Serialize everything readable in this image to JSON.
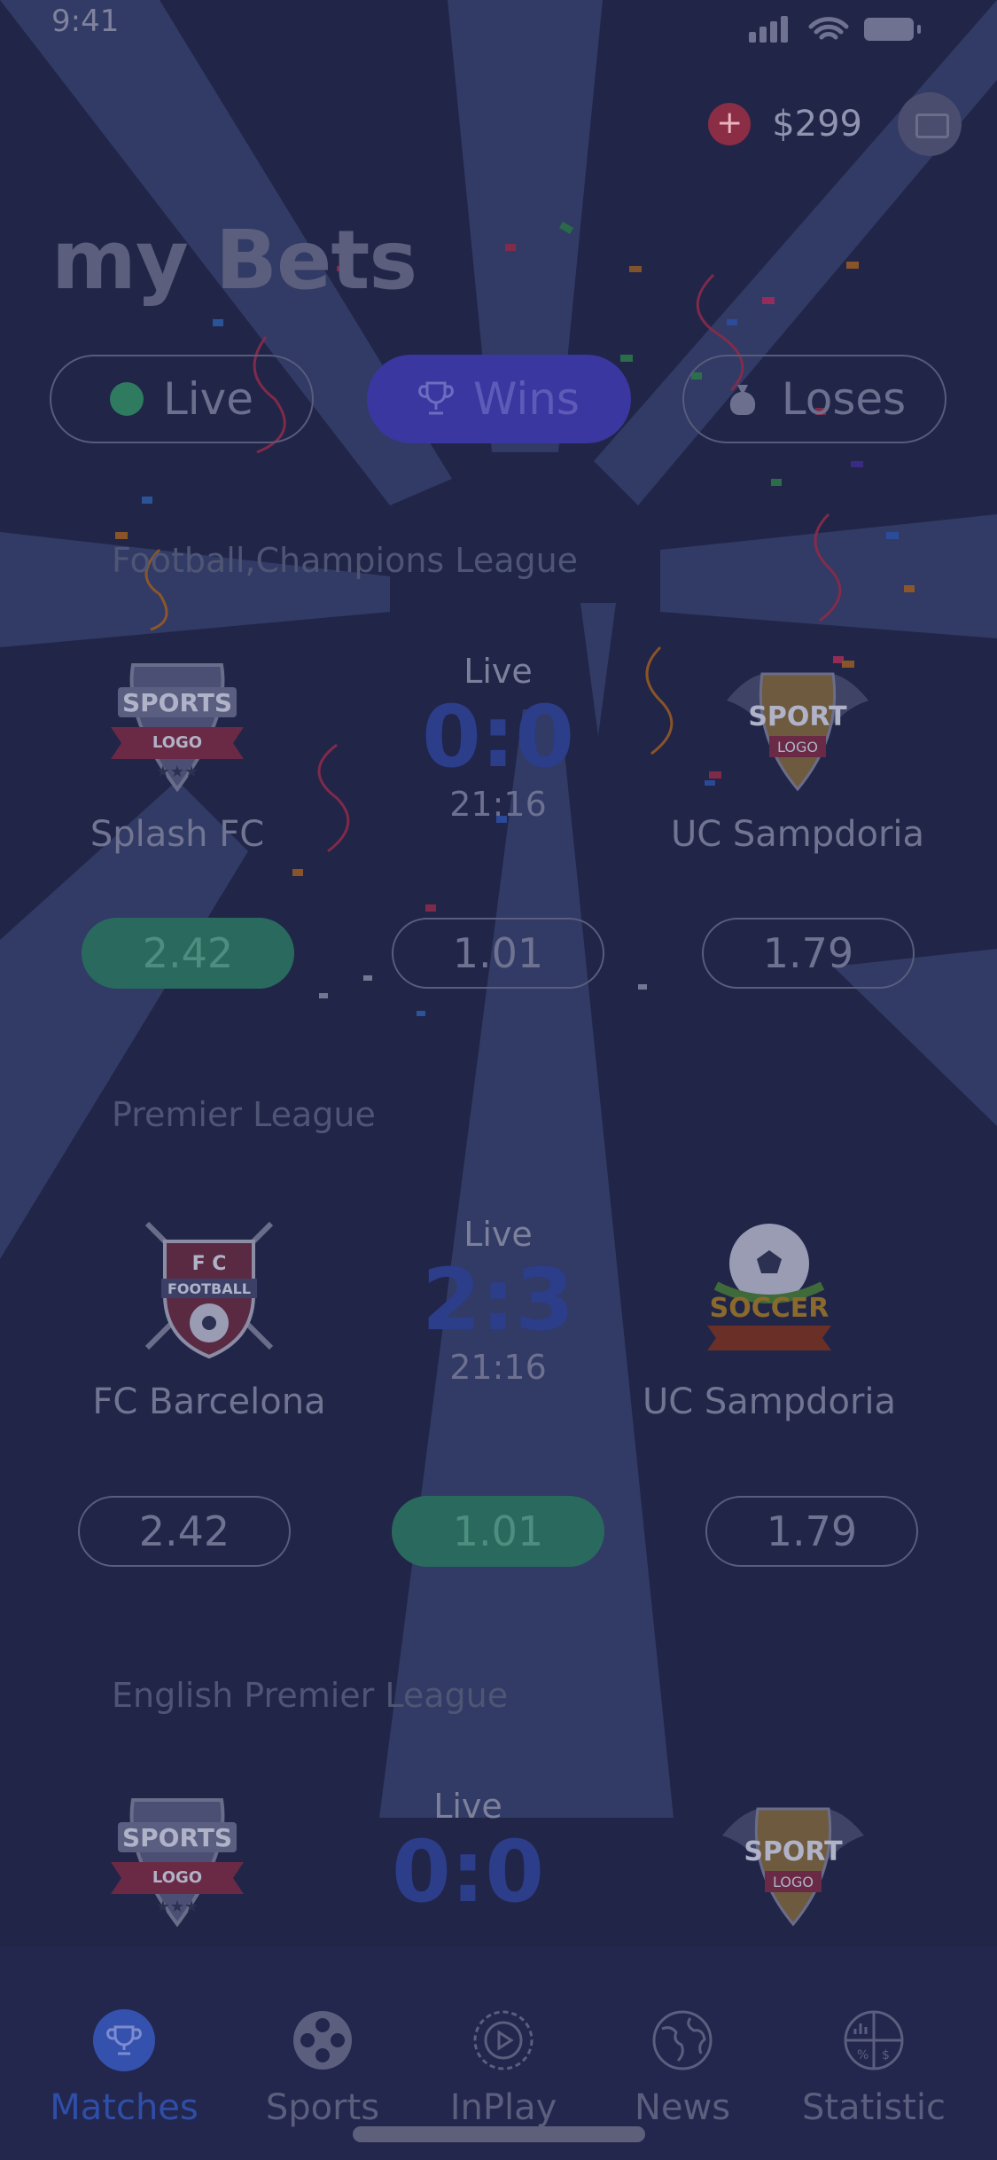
{
  "status_bar": {
    "time": "9:41"
  },
  "header": {
    "balance": "$299",
    "add_icon": "plus-icon",
    "avatar_icon": "avatar-icon"
  },
  "page_title": "my Bets",
  "filters": [
    {
      "label": "Live",
      "icon": "live-dot-icon",
      "active": false
    },
    {
      "label": "Wins",
      "icon": "trophy-icon",
      "active": true
    },
    {
      "label": "Loses",
      "icon": "money-bag-icon",
      "active": false
    }
  ],
  "matches": [
    {
      "league": "Football,Champions League",
      "home": {
        "name": "Splash FC",
        "logo": "sports-logo-badge"
      },
      "away": {
        "name": "UC Sampdoria",
        "logo": "sport-logo-wings"
      },
      "status": "Live",
      "score": "0:0",
      "clock": "21:16",
      "odds": [
        "2.42",
        "1.01",
        "1.79"
      ],
      "selected_odd": 0
    },
    {
      "league": "Premier League",
      "home": {
        "name": "FC Barcelona",
        "logo": "fc-football-shield"
      },
      "away": {
        "name": "UC Sampdoria",
        "logo": "soccer-badge"
      },
      "status": "Live",
      "score": "2:3",
      "clock": "21:16",
      "odds": [
        "2.42",
        "1.01",
        "1.79"
      ],
      "selected_odd": 1
    },
    {
      "league": "English Premier League",
      "home": {
        "name": "",
        "logo": "sports-logo-badge"
      },
      "away": {
        "name": "",
        "logo": "sport-logo-wings"
      },
      "status": "Live",
      "score": "0:0"
    }
  ],
  "tabbar": [
    {
      "label": "Matches",
      "icon": "trophy-icon",
      "active": true
    },
    {
      "label": "Sports",
      "icon": "film-reel-icon",
      "active": false
    },
    {
      "label": "InPlay",
      "icon": "play-icon",
      "active": false
    },
    {
      "label": "News",
      "icon": "globe-icon",
      "active": false
    },
    {
      "label": "Statistic",
      "icon": "chart-icon",
      "active": false
    }
  ],
  "colors": {
    "background": "#212548",
    "accent": "#3452ad",
    "selected_odd": "#2a6a5e",
    "overlay_rays": "#3a4470"
  }
}
